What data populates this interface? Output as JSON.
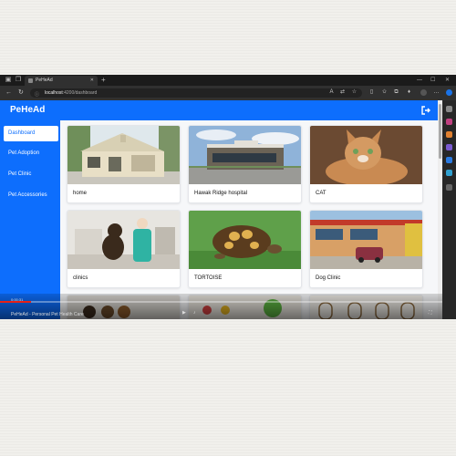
{
  "browser": {
    "tab_title": "PeHeAd",
    "url_host": "localhost",
    "url_path": ":4200/dashboard",
    "new_tab": "+",
    "controls": {
      "minimize": "—",
      "maximize": "☐",
      "close": "✕"
    }
  },
  "app": {
    "brand": "PeHeAd",
    "sidebar": [
      {
        "label": "Dashboard",
        "active": true
      },
      {
        "label": "Pet Adoption",
        "active": false
      },
      {
        "label": "Pet Clinic",
        "active": false
      },
      {
        "label": "Pet Accessories",
        "active": false
      }
    ],
    "cards": [
      {
        "title": "home",
        "image": "pet-house-image"
      },
      {
        "title": "Hawak Ridge hospital",
        "image": "hospital-building-image"
      },
      {
        "title": "CAT",
        "image": "kitten-image"
      },
      {
        "title": "clinics",
        "image": "vet-with-dog-image"
      },
      {
        "title": "TORTOISE",
        "image": "tortoise-image"
      },
      {
        "title": "Dog Clinic",
        "image": "clinic-storefront-image"
      }
    ]
  },
  "video": {
    "time": "0:00:31",
    "caption": "PeHeAd - Personal Pet Health Care",
    "progress": 0.07
  },
  "colors": {
    "primary": "#0d6efd",
    "progress": "#e62117"
  }
}
